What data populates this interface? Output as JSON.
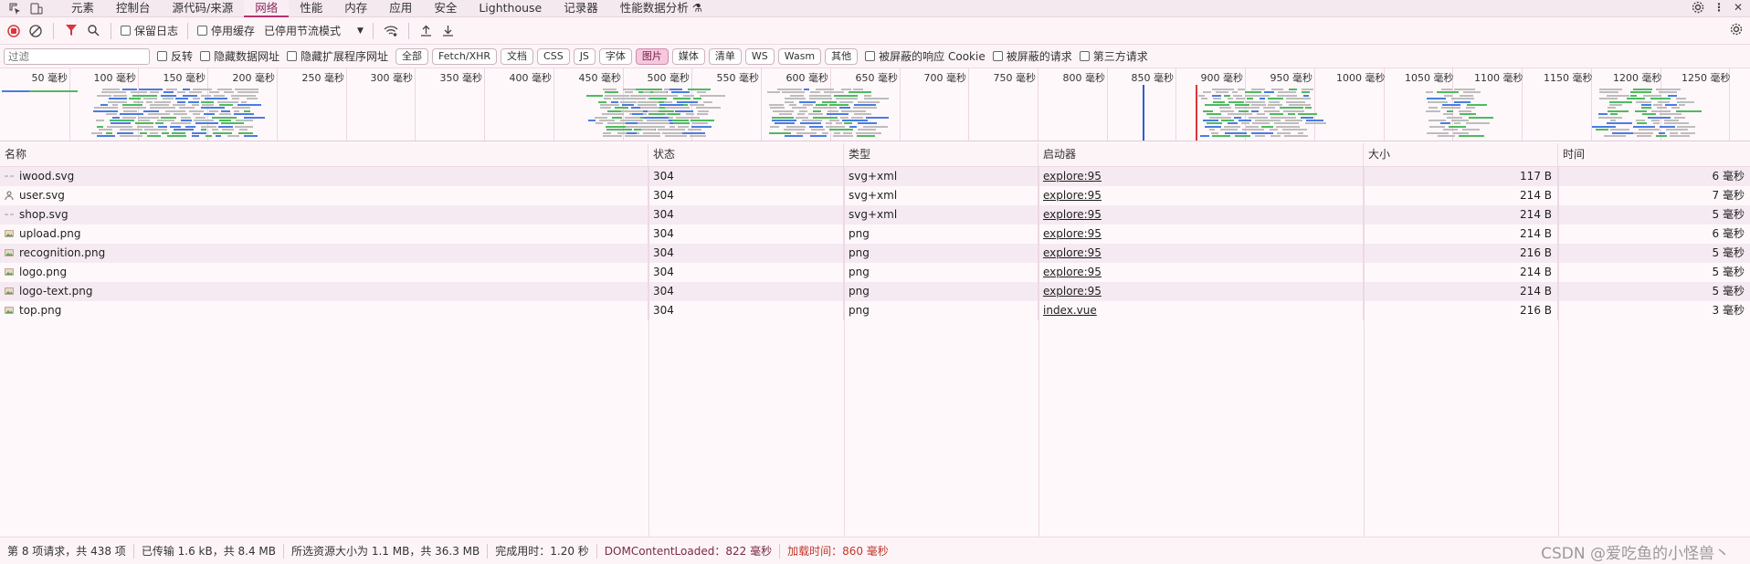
{
  "tabs": [
    "元素",
    "控制台",
    "源代码/来源",
    "网络",
    "性能",
    "内存",
    "应用",
    "安全",
    "Lighthouse",
    "记录器",
    "性能数据分析 ⚗"
  ],
  "active_tab": "网络",
  "toolbar": {
    "preserve_log": "保留日志",
    "disable_cache": "停用缓存",
    "throttle": "已停用节流模式"
  },
  "filter": {
    "placeholder": "过滤",
    "invert": "反转",
    "hide_data_urls": "隐藏数据网址",
    "hide_ext_urls": "隐藏扩展程序网址",
    "chips": [
      "全部",
      "Fetch/XHR",
      "文档",
      "CSS",
      "JS",
      "字体",
      "图片",
      "媒体",
      "清单",
      "WS",
      "Wasm",
      "其他"
    ],
    "active_chip": "图片",
    "blocked_cookies": "被屏蔽的响应 Cookie",
    "blocked_requests": "被屏蔽的请求",
    "third_party": "第三方请求"
  },
  "overview": {
    "ticks": [
      "50 毫秒",
      "100 毫秒",
      "150 毫秒",
      "200 毫秒",
      "250 毫秒",
      "300 毫秒",
      "350 毫秒",
      "400 毫秒",
      "450 毫秒",
      "500 毫秒",
      "550 毫秒",
      "600 毫秒",
      "650 毫秒",
      "700 毫秒",
      "750 毫秒",
      "800 毫秒",
      "850 毫秒",
      "900 毫秒",
      "950 毫秒",
      "1000 毫秒",
      "1050 毫秒",
      "1100 毫秒",
      "1150 毫秒",
      "1200 毫秒",
      "1250 毫秒"
    ]
  },
  "table": {
    "headers": [
      "名称",
      "状态",
      "类型",
      "启动器",
      "大小",
      "时间"
    ],
    "rows": [
      {
        "name": "iwood.svg",
        "status": "304",
        "type": "svg+xml",
        "initiator": "explore:95",
        "size": "117 B",
        "time": "6 毫秒",
        "icon": "svg-icon"
      },
      {
        "name": "user.svg",
        "status": "304",
        "type": "svg+xml",
        "initiator": "explore:95",
        "size": "214 B",
        "time": "7 毫秒",
        "icon": "user-icon"
      },
      {
        "name": "shop.svg",
        "status": "304",
        "type": "svg+xml",
        "initiator": "explore:95",
        "size": "214 B",
        "time": "5 毫秒",
        "icon": "svg-icon"
      },
      {
        "name": "upload.png",
        "status": "304",
        "type": "png",
        "initiator": "explore:95",
        "size": "214 B",
        "time": "6 毫秒",
        "icon": "image-icon"
      },
      {
        "name": "recognition.png",
        "status": "304",
        "type": "png",
        "initiator": "explore:95",
        "size": "216 B",
        "time": "5 毫秒",
        "icon": "image-icon"
      },
      {
        "name": "logo.png",
        "status": "304",
        "type": "png",
        "initiator": "explore:95",
        "size": "214 B",
        "time": "5 毫秒",
        "icon": "image-icon"
      },
      {
        "name": "logo-text.png",
        "status": "304",
        "type": "png",
        "initiator": "explore:95",
        "size": "214 B",
        "time": "5 毫秒",
        "icon": "image-icon"
      },
      {
        "name": "top.png",
        "status": "304",
        "type": "png",
        "initiator": "index.vue",
        "size": "216 B",
        "time": "3 毫秒",
        "icon": "image-icon"
      }
    ]
  },
  "status": {
    "requests": "第 8 项请求，共 438 项",
    "transferred": "已传输 1.6 kB，共 8.4 MB",
    "resources": "所选资源大小为 1.1 MB，共 36.3 MB",
    "finish": "完成用时：1.20 秒",
    "dom": "DOMContentLoaded：822 毫秒",
    "load": "加载时间：860 毫秒"
  },
  "watermark": "CSDN @爱吃鱼的小怪兽丶"
}
